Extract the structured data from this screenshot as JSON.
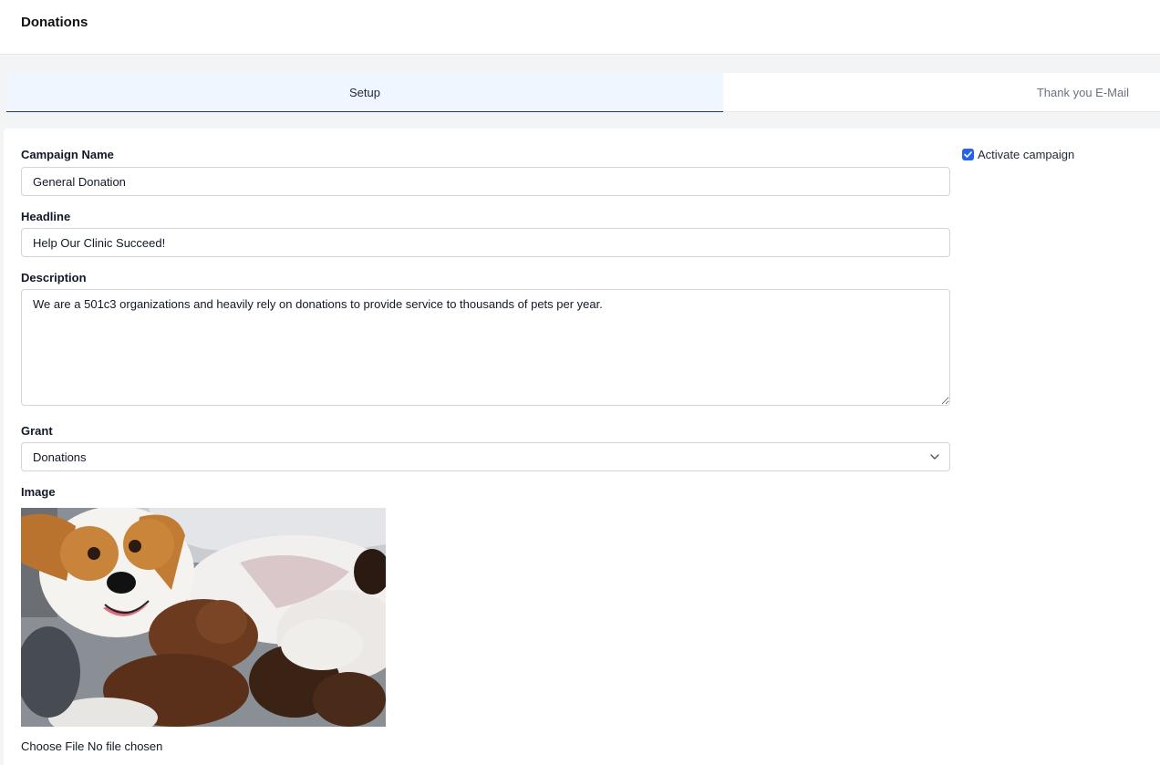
{
  "header": {
    "title": "Donations"
  },
  "tabs": [
    {
      "label": "Setup",
      "active": true
    },
    {
      "label": "Thank you E-Mail",
      "active": false
    }
  ],
  "form": {
    "campaign_name_label": "Campaign Name",
    "campaign_name_value": "General Donation",
    "headline_label": "Headline",
    "headline_value": "Help Our Clinic Succeed!",
    "description_label": "Description",
    "description_value": "We are a 501c3 organizations and heavily rely on donations to provide service to thousands of pets per year.",
    "grant_label": "Grant",
    "grant_value": "Donations",
    "image_label": "Image",
    "file_button": "Choose File",
    "file_status": "No file chosen",
    "activate_label": "Activate campaign",
    "activate_checked": true
  },
  "icons": {
    "select": "chevron-down-icon",
    "checkbox": "checkmark-icon"
  },
  "colors": {
    "accent": "#2563eb",
    "active_tab_bg": "#eff6ff",
    "active_tab_border": "#1e3a5f"
  }
}
